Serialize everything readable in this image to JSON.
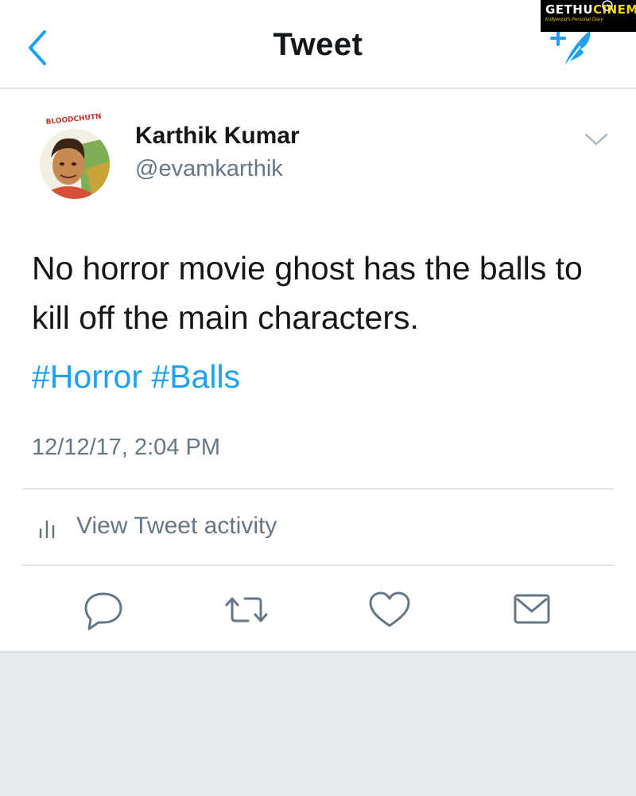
{
  "header": {
    "title": "Tweet",
    "back_icon": "chevron-left-icon",
    "compose_icon": "compose-tweet-icon"
  },
  "watermark": {
    "brand_part1": "GETHU",
    "brand_part2": "CINEMA",
    "tagline": "Kollywood's Personal Diary"
  },
  "tweet": {
    "author_name": "Karthik Kumar",
    "author_handle": "@evamkarthik",
    "avatar_label": "BLOODCHUTN",
    "text": "No horror movie ghost has the balls to kill off the main characters.",
    "hashtags": [
      "#Horror",
      "#Balls"
    ],
    "timestamp": "12/12/17, 2:04 PM",
    "activity_label": "View Tweet activity"
  },
  "actions": [
    "reply-icon",
    "retweet-icon",
    "like-icon",
    "message-icon"
  ],
  "colors": {
    "accent": "#1da1f2",
    "text_primary": "#14171a",
    "text_secondary": "#657786",
    "divider": "#e1e8ed",
    "bottom_background": "#e6ecf0"
  }
}
